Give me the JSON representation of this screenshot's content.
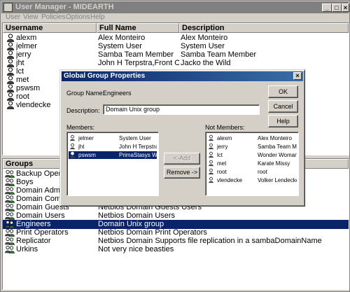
{
  "window": {
    "title": "User Manager - MIDEARTH",
    "btn_min": "_",
    "btn_max": "□",
    "btn_close": "×"
  },
  "menu": [
    "User",
    "View",
    "Policies",
    "Options",
    "Help"
  ],
  "users": {
    "headers": [
      "Username",
      "Full Name",
      "Description"
    ],
    "rows": [
      {
        "username": "alexm",
        "full_name": "Alex Monteiro",
        "description": "Alex Monteiro"
      },
      {
        "username": "jelmer",
        "full_name": "System User",
        "description": "System User"
      },
      {
        "username": "jerry",
        "full_name": "Samba Team Member",
        "description": "Samba Team Member"
      },
      {
        "username": "jht",
        "full_name": "John H Terpstra,Front Office",
        "description": "Jacko the Wild"
      },
      {
        "username": "lct",
        "full_name": "",
        "description": ""
      },
      {
        "username": "met",
        "full_name": "",
        "description": ""
      },
      {
        "username": "pswsm",
        "full_name": "",
        "description": ""
      },
      {
        "username": "root",
        "full_name": "",
        "description": ""
      },
      {
        "username": "vlendecke",
        "full_name": "",
        "description": ""
      }
    ]
  },
  "groups": {
    "header": "Groups",
    "rows": [
      {
        "name": "Backup Operators",
        "description": ""
      },
      {
        "name": "Boys",
        "description": ""
      },
      {
        "name": "Domain Admins",
        "description": ""
      },
      {
        "name": "Domain Computers",
        "description": ""
      },
      {
        "name": "Domain Guests",
        "description": "Netbios Domain Guests Users"
      },
      {
        "name": "Domain Users",
        "description": "Netbios Domain Users"
      },
      {
        "name": "Engineers",
        "description": "Domain Unix group",
        "selected": true
      },
      {
        "name": "Print Operators",
        "description": "Netbios Domain Print Operators"
      },
      {
        "name": "Replicator",
        "description": "Netbios Domain Supports file replication in a sambaDomainName"
      },
      {
        "name": "Urkins",
        "description": "Not very nice beasties"
      }
    ]
  },
  "dialog": {
    "title": "Global Group Properties",
    "close": "×",
    "group_name_label": "Group Name:",
    "group_name": "Engineers",
    "description_label": "Description:",
    "description_value": "Domain Unix group",
    "members_label": "Members:",
    "not_members_label": "Not Members:",
    "ok": "OK",
    "cancel": "Cancel",
    "help": "Help",
    "add": "<-Add",
    "remove": "Remove ->",
    "members": [
      {
        "user": "jelmer",
        "name": "System User"
      },
      {
        "user": "jht",
        "name": "John H Terpstra"
      },
      {
        "user": "pswsm",
        "name": "PrimaStasys We",
        "selected": true
      }
    ],
    "not_members": [
      {
        "user": "alexm",
        "name": "Alex Monteiro"
      },
      {
        "user": "jerry",
        "name": "Samba Team Me"
      },
      {
        "user": "lct",
        "name": "Wonder Woman"
      },
      {
        "user": "met",
        "name": "Karate Missy"
      },
      {
        "user": "root",
        "name": "root"
      },
      {
        "user": "vlendecke",
        "name": "Volker Lendecke"
      }
    ]
  }
}
